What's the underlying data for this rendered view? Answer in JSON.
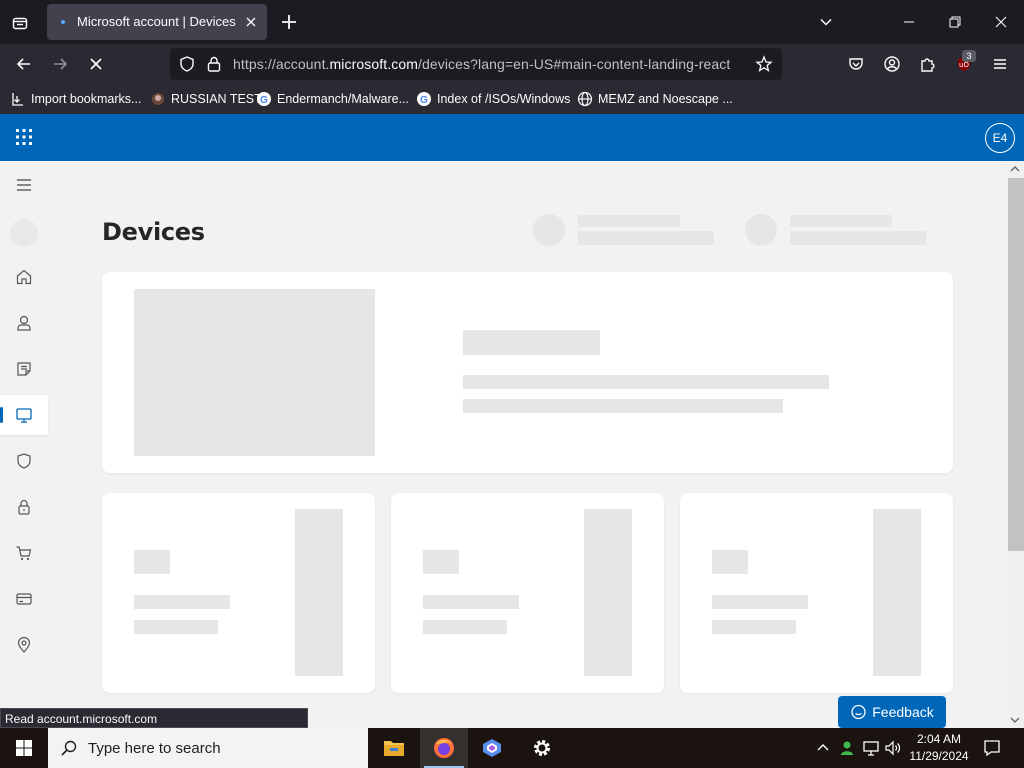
{
  "browser": {
    "tab_title": "Microsoft account | Devices",
    "url_prefix": "https://account.",
    "url_domain": "microsoft.com",
    "url_suffix": "/devices?lang=en-US#main-content-landing-react",
    "extension_badge": "3",
    "status_text": "Read account.microsoft.com"
  },
  "bookmarks": [
    {
      "label": "Import bookmarks...",
      "icon": "import-icon"
    },
    {
      "label": "RUSSIAN TEST",
      "icon": "site-favicon"
    },
    {
      "label": "Endermanch/Malware...",
      "icon": "google-icon"
    },
    {
      "label": "Index of /ISOs/Windows",
      "icon": "google-icon"
    },
    {
      "label": "MEMZ and Noescape ...",
      "icon": "globe-icon"
    }
  ],
  "header": {
    "avatar_initials": "E4",
    "brand_color": "#0067b8"
  },
  "page": {
    "title": "Devices",
    "feedback_label": "Feedback"
  },
  "sidenav": [
    {
      "name": "home",
      "icon": "home-icon"
    },
    {
      "name": "your-info",
      "icon": "person-icon"
    },
    {
      "name": "privacy",
      "icon": "document-icon"
    },
    {
      "name": "devices",
      "icon": "monitor-icon",
      "active": true
    },
    {
      "name": "security",
      "icon": "shield-icon"
    },
    {
      "name": "family",
      "icon": "lock-icon"
    },
    {
      "name": "orders",
      "icon": "cart-icon"
    },
    {
      "name": "payment",
      "icon": "card-icon"
    },
    {
      "name": "location",
      "icon": "location-icon"
    }
  ],
  "taskbar": {
    "search_placeholder": "Type here to search",
    "time": "2:04 AM",
    "date": "11/29/2024"
  }
}
